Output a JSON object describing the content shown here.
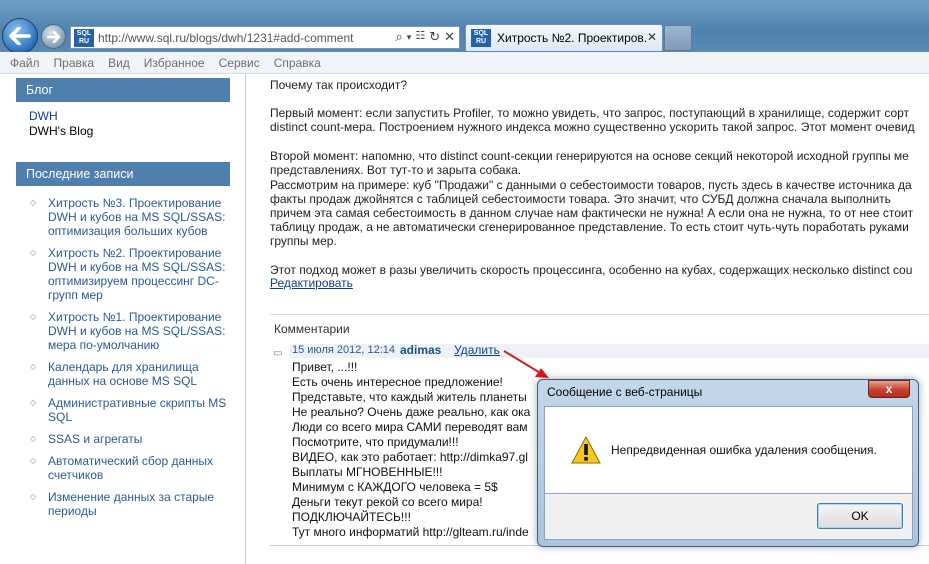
{
  "browser": {
    "url": "http://www.sql.ru/blogs/dwh/1231#add-comment",
    "site_badge": "SQL RU",
    "tab_title": "Хитрость №2. Проектиров...",
    "menu": [
      "Файл",
      "Правка",
      "Вид",
      "Избранное",
      "Сервис",
      "Справка"
    ]
  },
  "sidebar": {
    "blog_heading": "Блог",
    "blog_name": "DWH",
    "blog_title": "DWH's Blog",
    "recent_heading": "Последние записи",
    "posts": [
      "Хитрость №3. Проектирование DWH и кубов на MS SQL/SSAS: оптимизация больших кубов",
      "Хитрость №2. Проектирование DWH и кубов на MS SQL/SSAS: оптимизируем процессинг DC-групп мер",
      "Хитрость №1. Проектирование DWH и кубов на MS SQL/SSAS: мера по-умолчанию",
      "Календарь для хранилища данных на основе MS SQL",
      "Административные скрипты MS SQL",
      "SSAS и агрегаты",
      "Автоматический сбор данных счетчиков",
      "Изменение данных за старые периоды"
    ]
  },
  "article": {
    "lines": [
      "Почему так происходит?",
      "Первый момент: если запустить Profiler, то можно увидеть, что запрос, поступающий в хранилище, содержит сорт",
      "distinct count-мера. Построением нужного индекса можно существенно ускорить такой запрос. Этот момент очевид",
      "Второй момент: напомню, что distinct count-секции генерируются на основе секций некоторой исходной группы ме",
      "представлениях. Вот тут-то и зарыта собака.",
      "Рассмотрим на примере: куб \"Продажи\" с данными о себестоимости товаров, пусть здесь в качестве источника да",
      "факты продаж джойнятся с таблицей себестоимости товара. Это значит, что СУБД должна сначала выполнить",
      "причем эта самая себестоимость в данном случае нам фактически не нужна! А если она не нужна, то от нее стоит",
      "таблицу продаж, а не автоматически сгенерированное представление. То есть стоит чуть-чуть поработать руками",
      "группы мер.",
      "Этот подход может в разы увеличить скорость процессинга, особенно на кубах, содержащих несколько distinct cou"
    ],
    "edit_label": "Редактировать"
  },
  "comments": {
    "heading": "Комментарии",
    "date": "15 июля 2012, 12:14",
    "author": "adimas",
    "delete_label": "Удалить",
    "body": [
      "Привет, ...!!!",
      "Есть очень интересное предложение!",
      "Представьте, что каждый житель планеты",
      "Не реально? Очень даже реально, как ока",
      "Люди со всего мира САМИ переводят вам",
      "Посмотрите, что придумали!!!",
      "ВИДЕО, как это работает: http://dimka97.gl",
      "Выплаты МГНОВЕННЫЕ!!!",
      "Минимум с КАЖДОГО человека = 5$",
      "Деньги текут рекой со всего мира!",
      "ПОДКЛЮЧАЙТЕСЬ!!!",
      "Тут много информатий http://glteam.ru/inde"
    ]
  },
  "dialog": {
    "title": "Сообщение с веб-страницы",
    "message": "Непредвиденная ошибка удаления сообщения.",
    "ok_label": "OK",
    "close_symbol": "x"
  }
}
